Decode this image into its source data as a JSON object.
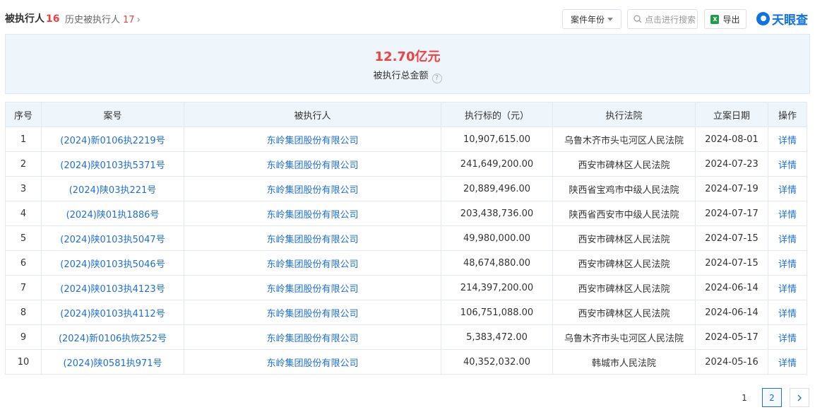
{
  "header": {
    "active_tab_label": "被执行人",
    "active_tab_count": "16",
    "history_tab_label": "历史被执行人",
    "history_tab_count": "17",
    "year_filter_label": "案件年份",
    "search_placeholder": "点击进行搜索",
    "export_label": "导出",
    "logo_text": "天眼查"
  },
  "summary": {
    "amount": "12.70亿元",
    "label": "被执行总金额",
    "help_icon": "question-circle-icon"
  },
  "table": {
    "columns": [
      "序号",
      "案号",
      "被执行人",
      "执行标的（元）",
      "执行法院",
      "立案日期",
      "操作"
    ],
    "rows": [
      {
        "no": "1",
        "case": "(2024)新0106执2219号",
        "party": "东岭集团股份有限公司",
        "amount": "10,907,615.00",
        "court": "乌鲁木齐市头屯河区人民法院",
        "date": "2024-08-01",
        "op": "详情"
      },
      {
        "no": "2",
        "case": "(2024)陕0103执5371号",
        "party": "东岭集团股份有限公司",
        "amount": "241,649,200.00",
        "court": "西安市碑林区人民法院",
        "date": "2024-07-23",
        "op": "详情"
      },
      {
        "no": "3",
        "case": "(2024)陕03执221号",
        "party": "东岭集团股份有限公司",
        "amount": "20,889,496.00",
        "court": "陕西省宝鸡市中级人民法院",
        "date": "2024-07-19",
        "op": "详情"
      },
      {
        "no": "4",
        "case": "(2024)陕01执1886号",
        "party": "东岭集团股份有限公司",
        "amount": "203,438,736.00",
        "court": "陕西省西安市中级人民法院",
        "date": "2024-07-17",
        "op": "详情"
      },
      {
        "no": "5",
        "case": "(2024)陕0103执5047号",
        "party": "东岭集团股份有限公司",
        "amount": "49,980,000.00",
        "court": "西安市碑林区人民法院",
        "date": "2024-07-15",
        "op": "详情"
      },
      {
        "no": "6",
        "case": "(2024)陕0103执5046号",
        "party": "东岭集团股份有限公司",
        "amount": "48,674,880.00",
        "court": "西安市碑林区人民法院",
        "date": "2024-07-15",
        "op": "详情"
      },
      {
        "no": "7",
        "case": "(2024)陕0103执4123号",
        "party": "东岭集团股份有限公司",
        "amount": "214,397,200.00",
        "court": "西安市碑林区人民法院",
        "date": "2024-06-14",
        "op": "详情"
      },
      {
        "no": "8",
        "case": "(2024)陕0103执4112号",
        "party": "东岭集团股份有限公司",
        "amount": "106,751,088.00",
        "court": "西安市碑林区人民法院",
        "date": "2024-06-14",
        "op": "详情"
      },
      {
        "no": "9",
        "case": "(2024)新0106执恢252号",
        "party": "东岭集团股份有限公司",
        "amount": "5,383,472.00",
        "court": "乌鲁木齐市头屯河区人民法院",
        "date": "2024-05-17",
        "op": "详情"
      },
      {
        "no": "10",
        "case": "(2024)陕0581执971号",
        "party": "东岭集团股份有限公司",
        "amount": "40,352,032.00",
        "court": "韩城市人民法院",
        "date": "2024-05-16",
        "op": "详情"
      }
    ]
  },
  "pagination": {
    "pages": [
      "1",
      "2"
    ],
    "current": "2",
    "next_icon": "chevron-right-icon"
  },
  "colors": {
    "accent": "#1e6fd9",
    "highlight": "#f04040",
    "summary_bg": "#eef6fb",
    "header_bg": "#eef5fb"
  }
}
